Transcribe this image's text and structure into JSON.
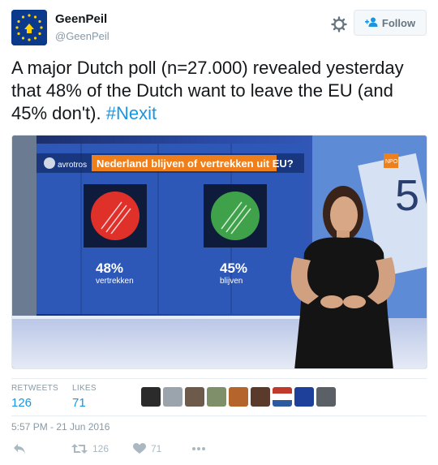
{
  "user": {
    "name": "GeenPeil",
    "handle": "@GeenPeil",
    "avatar_label": "GEENPEIL"
  },
  "follow_label": "Follow",
  "tweet": {
    "text": "A major Dutch poll (n=27.000) revealed yesterday that 48% of the Dutch want to leave the EU (and 45% don't). ",
    "hashtag": "#Nexit"
  },
  "media": {
    "channel": "avrotros",
    "headline": "Nederland blijven of vertrekken uit EU?",
    "logo": "NPO",
    "left_percent": "48%",
    "left_label": "vertrekken",
    "right_percent": "45%",
    "right_label": "blijven"
  },
  "stats": {
    "retweets_label": "RETWEETS",
    "retweets": "126",
    "likes_label": "LIKES",
    "likes": "71"
  },
  "timestamp": "5:57 PM - 21 Jun 2016",
  "actions": {
    "retweet_count": "126",
    "like_count": "71"
  },
  "colors": {
    "link": "#1b95e0",
    "muted": "#8899a6",
    "leave": "#e0302a",
    "stay": "#3fa24a"
  },
  "icons": [
    "gear-icon",
    "follow-user-icon",
    "reply-icon",
    "retweet-icon",
    "heart-icon",
    "more-icon"
  ]
}
